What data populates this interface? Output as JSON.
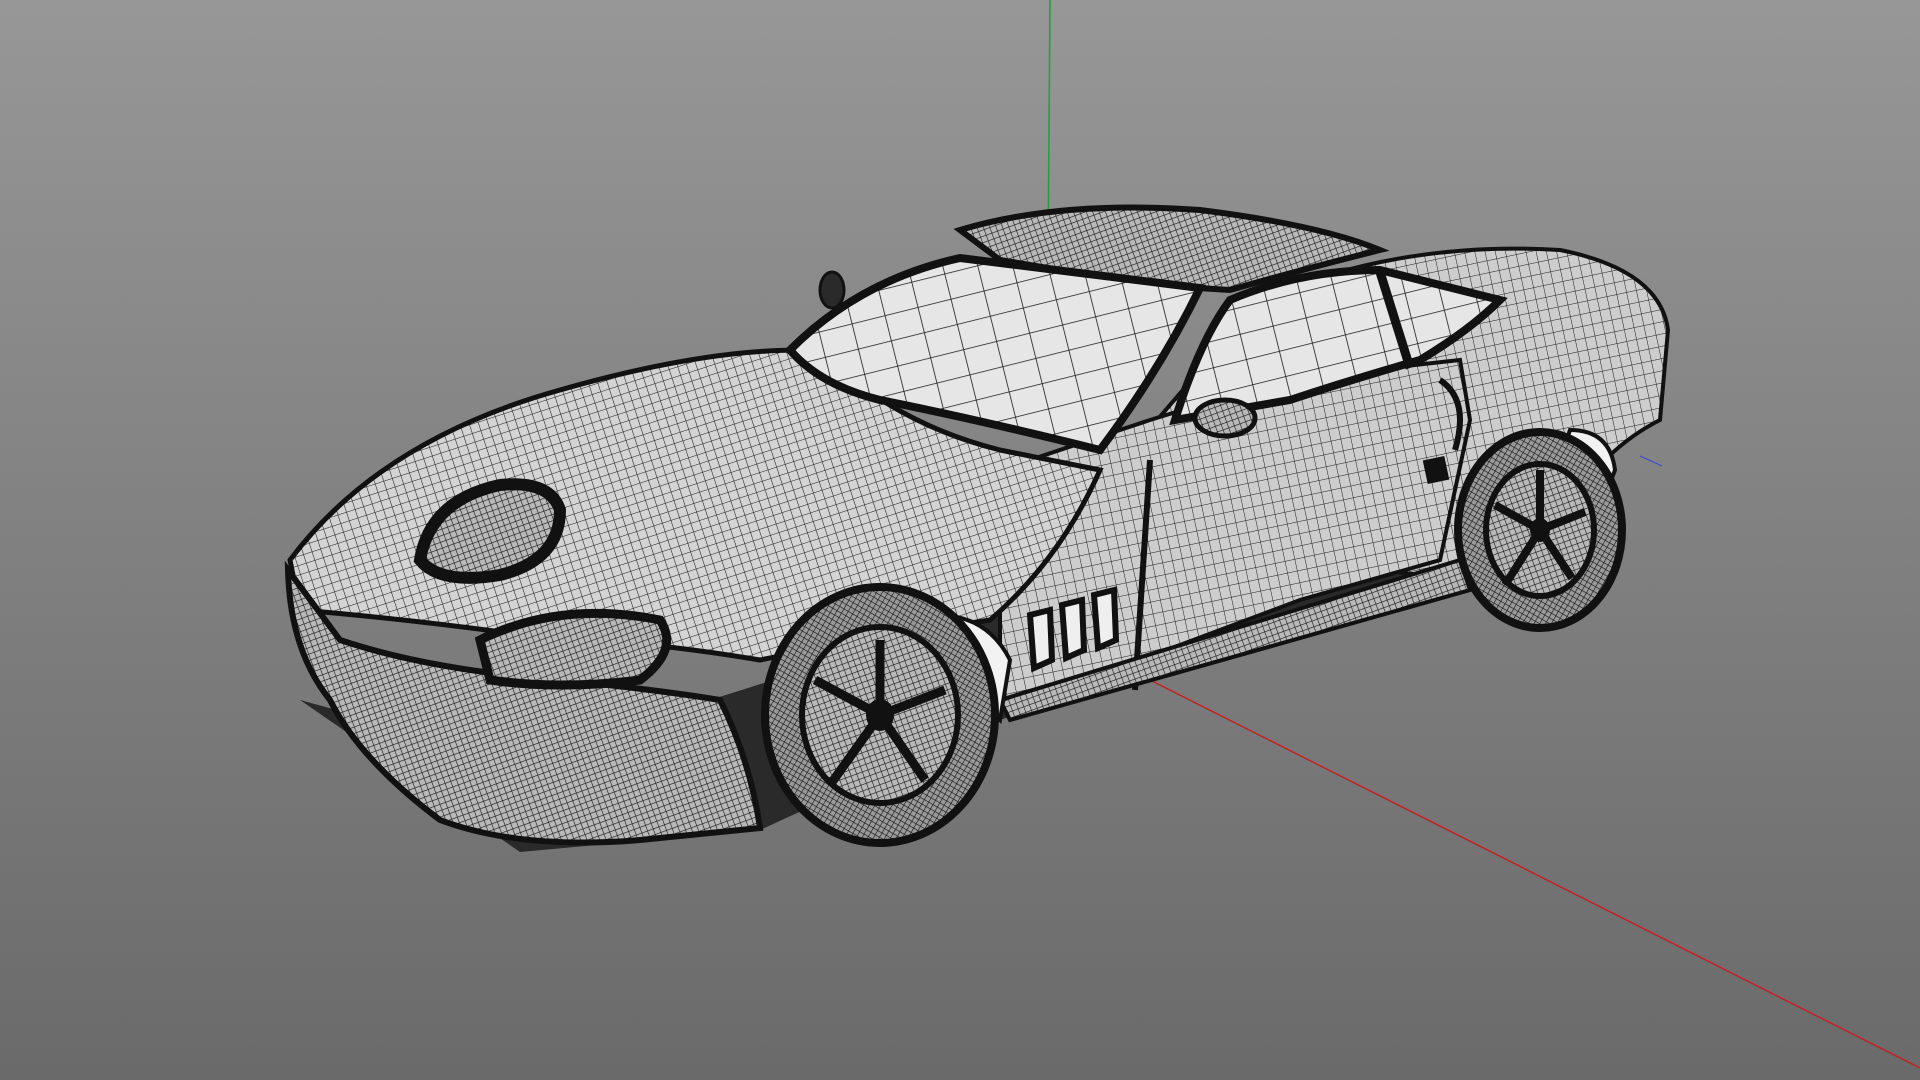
{
  "viewport": {
    "background_top": "#979797",
    "background_bottom": "#6a6a6a",
    "shading_mode": "wireframe-on-shaded"
  },
  "axes": {
    "x_axis_color": "#c81e1e",
    "y_axis_color": "#1fa33a",
    "z_axis_color": "#3a4fd0"
  },
  "model": {
    "type": "sports-car",
    "wire_color": "#1a1a1a",
    "surface_color": "#d8d8d8",
    "glass_color": "#e9e9e9"
  }
}
